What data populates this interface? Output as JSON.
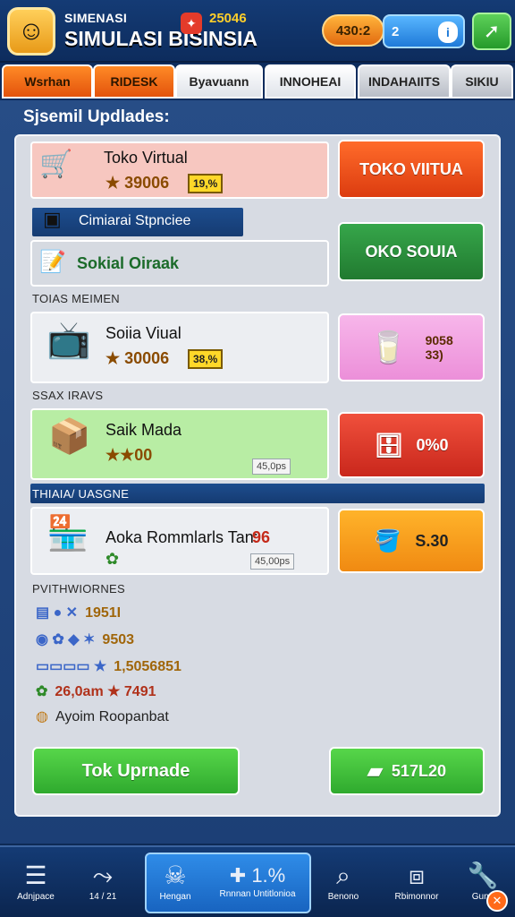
{
  "header": {
    "subtitle": "SIMENASI",
    "title": "SIMULASI BISINSIA",
    "score": "25046",
    "coins": "430:2",
    "blue_value": "2",
    "avatar_icon": "player-face"
  },
  "tabs": [
    "Wsrhan",
    "RIDESK",
    "Byavuann",
    "INNOHEAI",
    "INDAHAIITS",
    "SIKIU"
  ],
  "section_title": "Sjsemil Updlades:",
  "items": {
    "toko_virtual": {
      "name": "Toko Virtual",
      "price": "★ 39006",
      "tag": "19,%",
      "button": "TOKO VIITUA"
    },
    "strip1": {
      "label": "Cimiarai Stpnciee"
    },
    "sosial": {
      "name": "Sokial Oiraak",
      "button": "OKO SOUIA"
    },
    "subhead1": "TOIAS MEIMEN",
    "sotia": {
      "name": "Soiia Viual",
      "price": "★ 30006",
      "tag": "38,%",
      "right_value_1": "9058",
      "right_value_2": "33)"
    },
    "subhead2": "SSAX IRAVS",
    "sak": {
      "name": "Saik Mada",
      "price": "★★00",
      "chip": "45,0ps",
      "button": "0%0"
    },
    "subhead3": "THIAIA/ UASGNE",
    "aoka": {
      "name": "Aoka Rommlarls Tan:",
      "suffix": "96",
      "chip": "45,00ps",
      "button": "S.30"
    },
    "subhead4": "PVITHWIORNES"
  },
  "list": [
    {
      "text": "1951I"
    },
    {
      "text": "9503"
    },
    {
      "text": "1,5056851"
    },
    {
      "text": "26,0am ★ 7491"
    },
    {
      "text": "Ayoim Roopanbat"
    }
  ],
  "footer_buttons": {
    "left": "Tok Uprnade",
    "right": "517L20"
  },
  "bottom_nav": [
    {
      "label": "Adnjpace",
      "icon": "menu-icon"
    },
    {
      "label": "14 / 21",
      "icon": "share-icon"
    },
    {
      "label": "Hengan",
      "icon": "skull-icon"
    },
    {
      "label": "Rnnnan Untitlonioa",
      "icon": "plus-icon",
      "value": "1.%"
    },
    {
      "label": "Benono",
      "icon": "search-icon"
    },
    {
      "label": "Rbimonnor",
      "icon": "crate-icon"
    },
    {
      "label": "Gunn",
      "icon": "wrench-icon"
    }
  ],
  "colors": {
    "accent_orange": "#e3530c",
    "accent_green": "#217a30",
    "accent_blue": "#1864c0"
  }
}
